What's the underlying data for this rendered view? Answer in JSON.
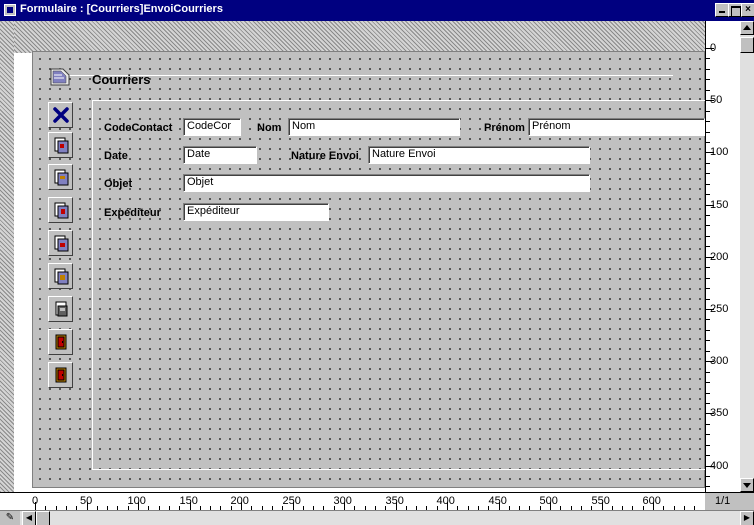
{
  "window": {
    "title": "Formulaire : [Courriers]EnvoiCourriers"
  },
  "form": {
    "title": "Courriers",
    "fields": [
      {
        "label": "CodeContact",
        "value": "CodeCor"
      },
      {
        "label": "Nom",
        "value": "Nom"
      },
      {
        "label": "Prénom",
        "value": "Prénom"
      },
      {
        "label": "Date",
        "value": "Date"
      },
      {
        "label": "Nature Envoi",
        "value": "Nature Envoi"
      },
      {
        "label": "Objet",
        "value": "Objet"
      },
      {
        "label": "Expéditeur",
        "value": "Expéditeur"
      }
    ]
  },
  "toolbar_icons": [
    "delete-x-icon",
    "record-icon",
    "record-icon",
    "record-icon",
    "record-icon",
    "record-icon",
    "record-icon",
    "exit-door-icon",
    "exit-door-icon"
  ],
  "vruler": [
    "0",
    "50",
    "100",
    "150",
    "200",
    "250",
    "300",
    "350",
    "400"
  ],
  "hruler": [
    "0",
    "50",
    "100",
    "150",
    "200",
    "250",
    "300",
    "350",
    "400",
    "450",
    "500",
    "550",
    "600"
  ],
  "page_indicator": "1/1",
  "colors": {
    "titlebar": "#000080",
    "panel": "#c0c0c0",
    "delete_icon": "#000080"
  }
}
